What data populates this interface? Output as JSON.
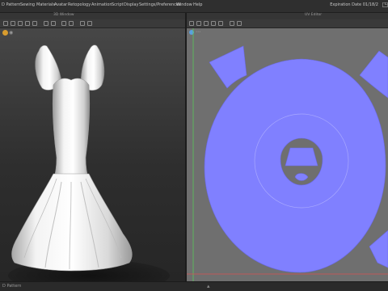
{
  "menu": {
    "items": [
      "D Pattern",
      "Sewing",
      "Materials",
      "Avatar",
      "Retopology",
      "Animation",
      "Script",
      "Display",
      "Settings/Preferences",
      "Window",
      "Help"
    ],
    "expiration": "Expiration Date 01/18/2"
  },
  "views": {
    "left_title": "3D Window",
    "right_title": "UV Editor"
  },
  "status": {
    "label": "D Pattern"
  },
  "colors": {
    "uv_fill": "#8080ff",
    "uv_background": "#6f6f6f",
    "garment": "#f2f2f2"
  }
}
